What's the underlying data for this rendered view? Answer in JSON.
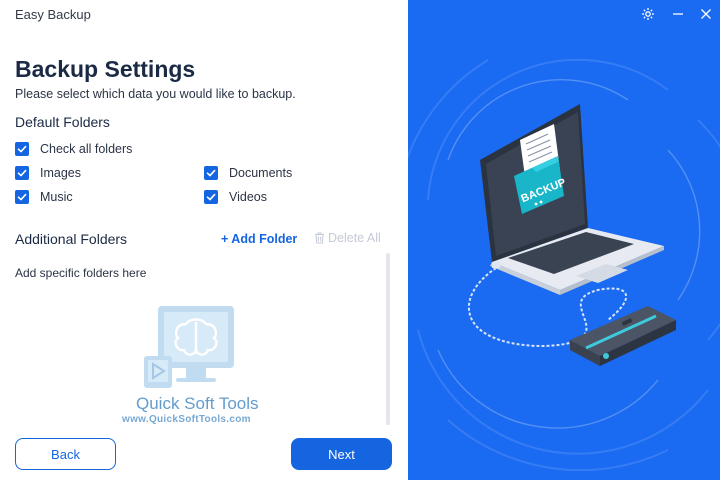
{
  "app": {
    "title": "Easy Backup"
  },
  "header": {
    "title": "Backup Settings",
    "subtitle": "Please select which data you would like to backup."
  },
  "default_folders": {
    "title": "Default Folders",
    "check_all": {
      "label": "Check all folders",
      "checked": true
    },
    "items": [
      {
        "label": "Images",
        "checked": true
      },
      {
        "label": "Documents",
        "checked": true
      },
      {
        "label": "Music",
        "checked": true
      },
      {
        "label": "Videos",
        "checked": true
      }
    ]
  },
  "additional_folders": {
    "title": "Additional Folders",
    "add_label": "+ Add Folder",
    "delete_label": "Delete All",
    "hint": "Add specific folders here"
  },
  "watermark": {
    "text": "Quick Soft Tools",
    "url": "www.QuickSoftTools.com"
  },
  "footer": {
    "back_label": "Back",
    "next_label": "Next"
  },
  "illustration": {
    "folder_label": "BACKUP"
  },
  "icons": {
    "settings": "gear-icon",
    "minimize": "minimize-icon",
    "close": "close-icon",
    "delete": "trash-icon"
  },
  "colors": {
    "accent": "#1565e0",
    "panel_blue": "#1a6af2",
    "disabled": "#c4cad6"
  }
}
